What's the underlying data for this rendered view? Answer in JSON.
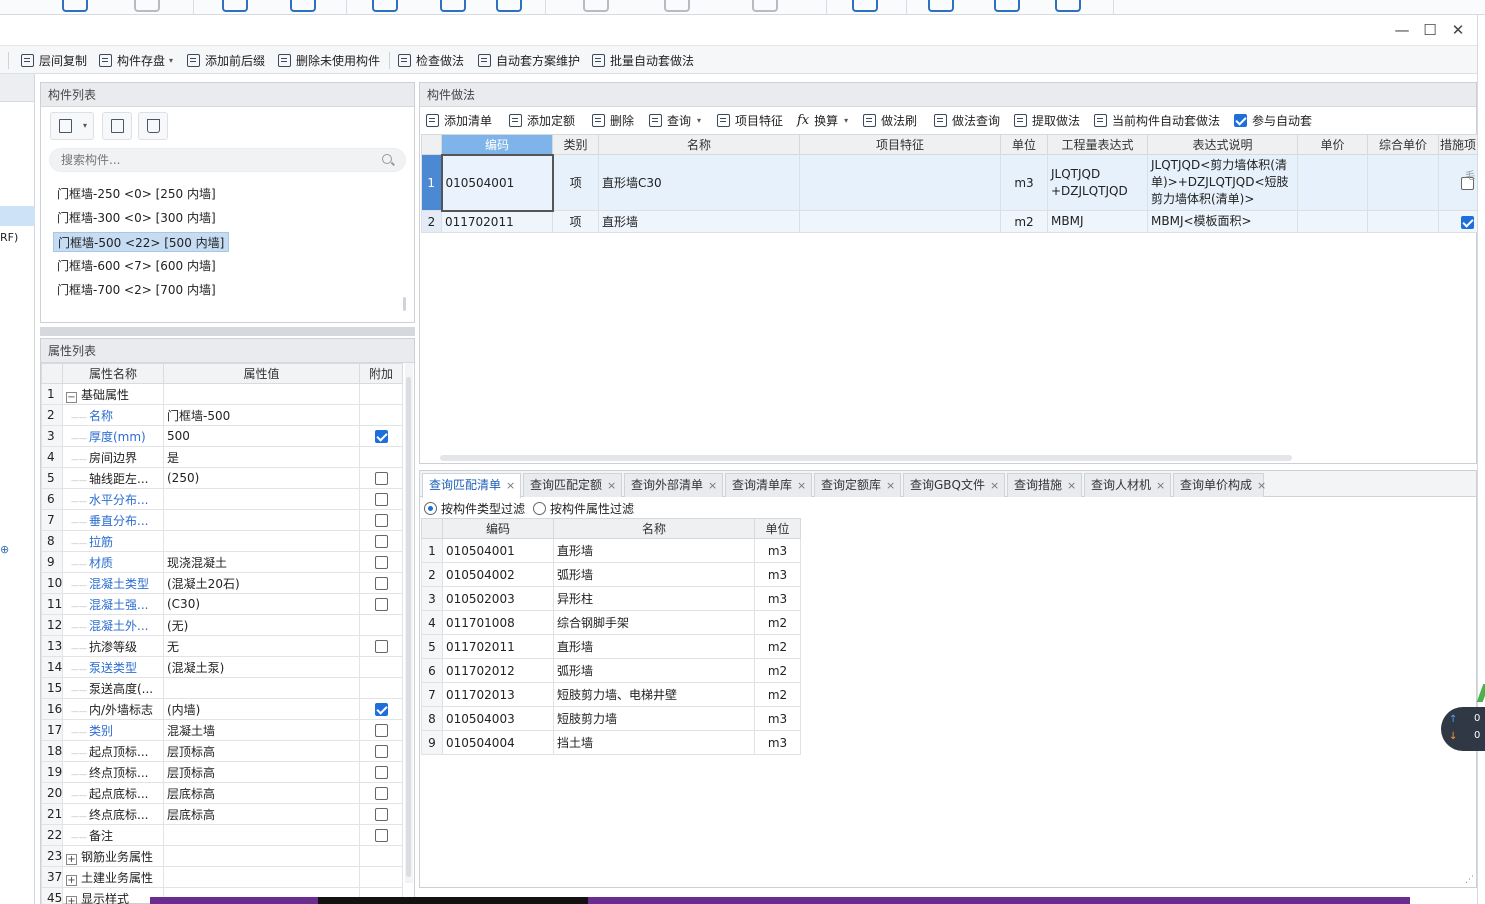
{
  "window": {
    "minimize": "—",
    "maximize": "☐",
    "close": "✕"
  },
  "toolbar": {
    "items": [
      "层间复制",
      "构件存盘",
      "添加前后缀",
      "删除未使用构件",
      "检查做法",
      "自动套方案维护",
      "批量自动套做法"
    ]
  },
  "left_strip": {
    "partial_text": "RF)"
  },
  "component_list": {
    "title": "构件列表",
    "search_placeholder": "搜索构件...",
    "items": [
      "门框墙-250 <0> [250 内墙]",
      "门框墙-300 <0> [300 内墙]",
      "门框墙-500 <22> [500 内墙]",
      "门框墙-600 <7> [600 内墙]",
      "门框墙-700 <2> [700 内墙]"
    ],
    "selected_index": 2
  },
  "property_list": {
    "title": "属性列表",
    "headers": [
      "属性名称",
      "属性值",
      "附加"
    ],
    "rows": [
      {
        "no": "1",
        "name": "基础属性",
        "value": "",
        "check": null,
        "blue": false,
        "group": "minus"
      },
      {
        "no": "2",
        "name": "名称",
        "value": "门框墙-500",
        "check": null,
        "blue": true
      },
      {
        "no": "3",
        "name": "厚度(mm)",
        "value": "500",
        "check": true,
        "blue": true
      },
      {
        "no": "4",
        "name": "房间边界",
        "value": "是",
        "check": null,
        "blue": false
      },
      {
        "no": "5",
        "name": "轴线距左...",
        "value": "(250)",
        "check": false,
        "blue": false
      },
      {
        "no": "6",
        "name": "水平分布...",
        "value": "",
        "check": false,
        "blue": true
      },
      {
        "no": "7",
        "name": "垂直分布...",
        "value": "",
        "check": false,
        "blue": true
      },
      {
        "no": "8",
        "name": "拉筋",
        "value": "",
        "check": false,
        "blue": true
      },
      {
        "no": "9",
        "name": "材质",
        "value": "现浇混凝土",
        "check": false,
        "blue": true
      },
      {
        "no": "10",
        "name": "混凝土类型",
        "value": "(混凝土20石)",
        "check": false,
        "blue": true
      },
      {
        "no": "11",
        "name": "混凝土强...",
        "value": "(C30)",
        "check": false,
        "blue": true
      },
      {
        "no": "12",
        "name": "混凝土外...",
        "value": "(无)",
        "check": null,
        "blue": true
      },
      {
        "no": "13",
        "name": "抗渗等级",
        "value": "无",
        "check": false,
        "blue": false
      },
      {
        "no": "14",
        "name": "泵送类型",
        "value": "(混凝土泵)",
        "check": null,
        "blue": true
      },
      {
        "no": "15",
        "name": "泵送高度(...",
        "value": "",
        "check": null,
        "blue": false
      },
      {
        "no": "16",
        "name": "内/外墙标志",
        "value": "(内墙)",
        "check": true,
        "blue": false
      },
      {
        "no": "17",
        "name": "类别",
        "value": "混凝土墙",
        "check": false,
        "blue": true
      },
      {
        "no": "18",
        "name": "起点顶标...",
        "value": "层顶标高",
        "check": false,
        "blue": false
      },
      {
        "no": "19",
        "name": "终点顶标...",
        "value": "层顶标高",
        "check": false,
        "blue": false
      },
      {
        "no": "20",
        "name": "起点底标...",
        "value": "层底标高",
        "check": false,
        "blue": false
      },
      {
        "no": "21",
        "name": "终点底标...",
        "value": "层底标高",
        "check": false,
        "blue": false
      },
      {
        "no": "22",
        "name": "备注",
        "value": "",
        "check": false,
        "blue": false
      },
      {
        "no": "23",
        "name": "钢筋业务属性",
        "value": "",
        "check": null,
        "blue": false,
        "group": "plus"
      },
      {
        "no": "37",
        "name": "土建业务属性",
        "value": "",
        "check": null,
        "blue": false,
        "group": "plus"
      },
      {
        "no": "45",
        "name": "显示样式",
        "value": "",
        "check": null,
        "blue": false,
        "group": "plus"
      }
    ]
  },
  "method_panel": {
    "title": "构件做法",
    "toolbar": [
      "添加清单",
      "添加定额",
      "删除",
      "查询",
      "项目特征",
      "换算",
      "做法刷",
      "做法查询",
      "提取做法",
      "当前构件自动套做法",
      "参与自动套"
    ],
    "auto_apply_checked": true,
    "headers": [
      "编码",
      "类别",
      "名称",
      "项目特征",
      "单位",
      "工程量表达式",
      "表达式说明",
      "单价",
      "综合单价",
      "措施项"
    ],
    "rows": [
      {
        "no": "1",
        "code": "010504001",
        "type": "项",
        "name": "直形墙C30",
        "feature": "",
        "unit": "m3",
        "expr": "JLQTJQD +DZJLQTJQD",
        "desc": "JLQTJQD<剪力墙体积(清单)>+DZJLQTJQD<短肢剪力墙体积(清单)>",
        "price": "",
        "total": "",
        "measure": false
      },
      {
        "no": "2",
        "code": "011702011",
        "type": "项",
        "name": "直形墙",
        "feature": "",
        "unit": "m2",
        "expr": "MBMJ",
        "desc": "MBMJ<模板面积>",
        "price": "",
        "total": "",
        "measure": true
      }
    ]
  },
  "query_panel": {
    "tabs": [
      "查询匹配清单",
      "查询匹配定额",
      "查询外部清单",
      "查询清单库",
      "查询定额库",
      "查询GBQ文件",
      "查询措施",
      "查询人材机",
      "查询单价构成"
    ],
    "active_tab": 0,
    "tab_close": "×",
    "filters": [
      "按构件类型过滤",
      "按构件属性过滤"
    ],
    "active_filter": 0,
    "headers": [
      "编码",
      "名称",
      "单位"
    ],
    "rows": [
      {
        "no": "1",
        "code": "010504001",
        "name": "直形墙",
        "unit": "m3"
      },
      {
        "no": "2",
        "code": "010504002",
        "name": "弧形墙",
        "unit": "m3"
      },
      {
        "no": "3",
        "code": "010502003",
        "name": "异形柱",
        "unit": "m3"
      },
      {
        "no": "4",
        "code": "011701008",
        "name": "综合钢脚手架",
        "unit": "m2"
      },
      {
        "no": "5",
        "code": "011702011",
        "name": "直形墙",
        "unit": "m2"
      },
      {
        "no": "6",
        "code": "011702012",
        "name": "弧形墙",
        "unit": "m2"
      },
      {
        "no": "7",
        "code": "011702013",
        "name": "短肢剪力墙、电梯井壁",
        "unit": "m2"
      },
      {
        "no": "8",
        "code": "010504003",
        "name": "短肢剪力墙",
        "unit": "m3"
      },
      {
        "no": "9",
        "code": "010504004",
        "name": "挡土墙",
        "unit": "m3"
      }
    ]
  },
  "float_widget": {
    "up_value": "0",
    "down_value": "0"
  }
}
